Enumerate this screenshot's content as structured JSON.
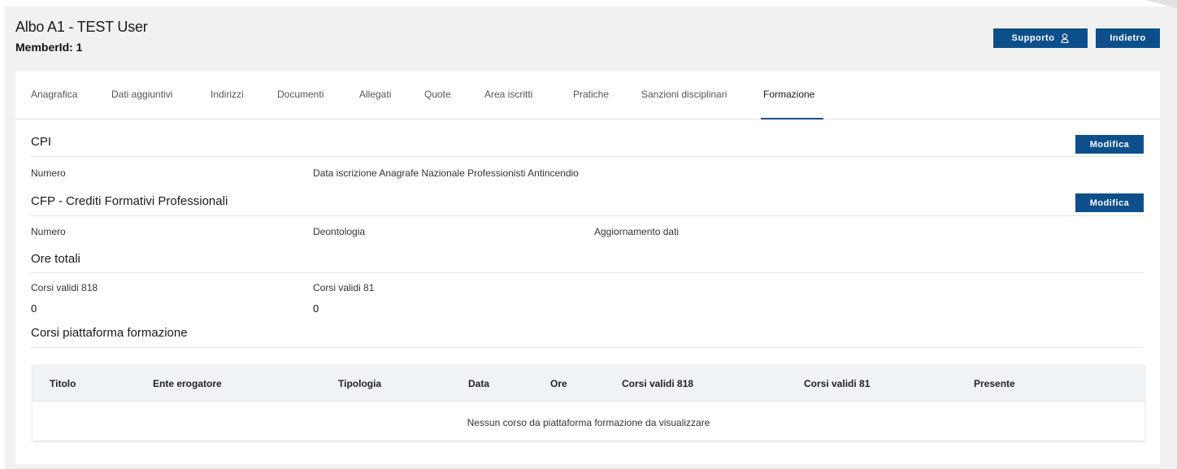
{
  "header": {
    "title": "Albo A1 - TEST User",
    "member_id": "MemberId: 1",
    "supporto_label": "Supporto",
    "indietro_label": "Indietro"
  },
  "tabs": [
    {
      "label": "Anagrafica"
    },
    {
      "label": "Dati aggiuntivi"
    },
    {
      "label": "Indirizzi"
    },
    {
      "label": "Documenti"
    },
    {
      "label": "Allegati"
    },
    {
      "label": "Quote"
    },
    {
      "label": "Area iscritti"
    },
    {
      "label": "Pratiche"
    },
    {
      "label": "Sanzioni disciplinari"
    },
    {
      "label": "Formazione",
      "active": true
    }
  ],
  "cpi": {
    "title": "CPI",
    "modifica_label": "Modifica",
    "numero_label": "Numero",
    "data_iscrizione_label": "Data iscrizione Anagrafe Nazionale Professionisti Antincendio"
  },
  "cfp": {
    "title": "CFP - Crediti Formativi Professionali",
    "modifica_label": "Modifica",
    "numero_label": "Numero",
    "deontologia_label": "Deontologia",
    "aggiornamento_label": "Aggiornamento dati"
  },
  "ore_totali": {
    "title": "Ore totali",
    "corsi_818_label": "Corsi validi 818",
    "corsi_818_value": "0",
    "corsi_81_label": "Corsi validi 81",
    "corsi_81_value": "0"
  },
  "corsi": {
    "title": "Corsi piattaforma formazione",
    "columns": [
      "Titolo",
      "Ente erogatore",
      "Tipologia",
      "Data",
      "Ore",
      "Corsi validi 818",
      "Corsi validi 81",
      "Presente"
    ],
    "empty_message": "Nessun corso da piattaforma formazione da visualizzare"
  },
  "colors": {
    "accent": "#0d4f8b",
    "page_bg": "#f1f1f2",
    "table_header_bg": "#eff3f6"
  }
}
